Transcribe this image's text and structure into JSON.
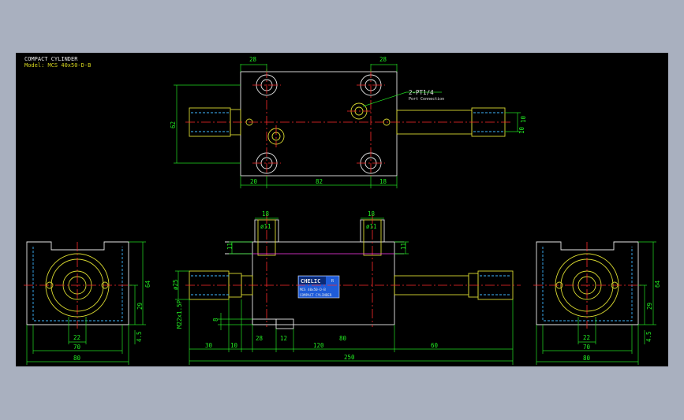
{
  "title_block": {
    "name": "COMPACT CYLINDER",
    "model": "Model: MCS 40x50-D-B"
  },
  "nameplate": {
    "brand": "CHELIC",
    "model": "MCS 40x50-D-B",
    "name": "COMPACT CYLINDER",
    "mark": "R"
  },
  "annotations": {
    "port_spec": "2-PT1/4",
    "port_label": "Port Connection"
  },
  "dimensions": {
    "top_w_left": "28",
    "top_w_right": "28",
    "top_h": "62",
    "top_right_v1": "10",
    "top_right_v2": "10",
    "top_b_20": "20",
    "top_b_82": "82",
    "top_b_18": "18",
    "front_18_left": "18",
    "front_18_right": "18",
    "front_d11_left": "ø11",
    "front_d11_right": "ø11",
    "front_11_left": "11",
    "front_11_right": "11",
    "front_rod_dia": "ø25",
    "front_thread": "M22x1.5P",
    "front_8": "8",
    "front_30": "30",
    "front_10": "10",
    "front_28": "28",
    "front_12": "12",
    "front_80": "80",
    "front_120": "120",
    "front_60": "60",
    "front_250": "250",
    "side_64": "64",
    "side_29": "29",
    "side_4_5": "4.5",
    "side_22": "22",
    "side_70": "70",
    "side_80": "80"
  },
  "colors": {
    "background": "#a9b0bf",
    "canvas": "#000000",
    "dimension": "#22dd22",
    "outline": "#e8e8e8",
    "rod": "#d8d830",
    "hidden": "#3fb7ff",
    "centerline": "#ff2b2b",
    "nameplate": "#1e5bd8"
  }
}
